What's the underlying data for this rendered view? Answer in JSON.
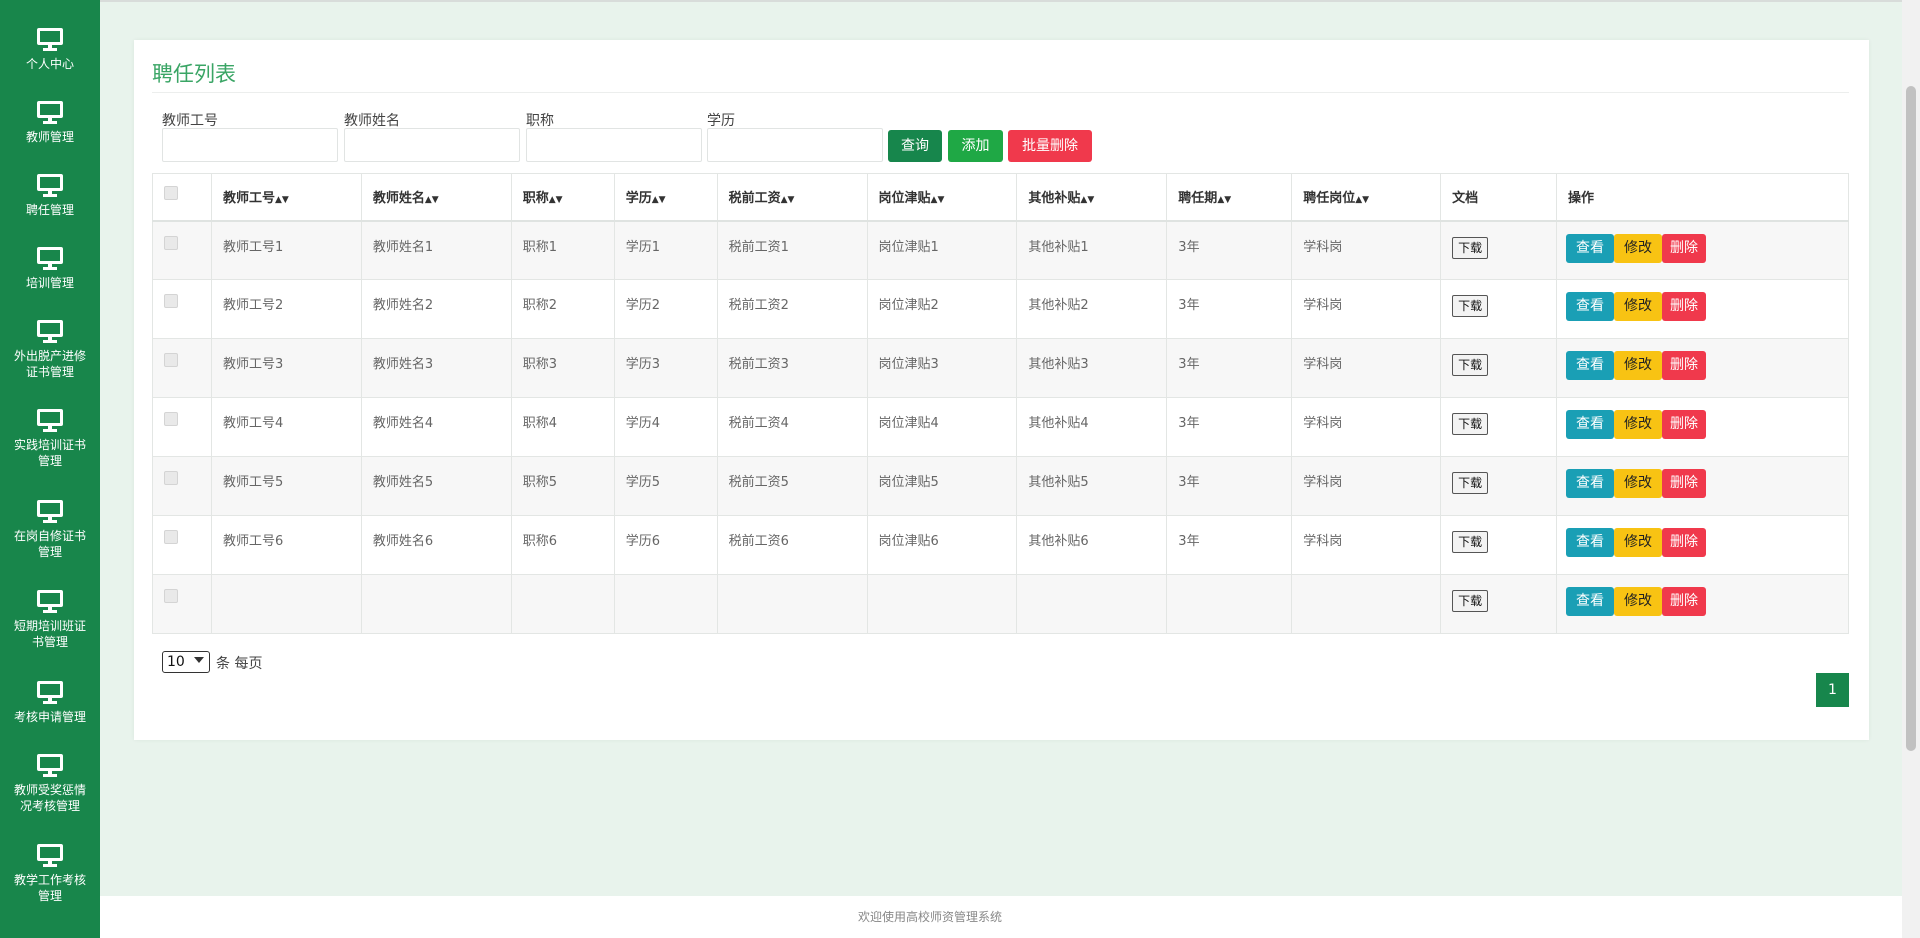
{
  "sidebar": {
    "items": [
      {
        "label": "个人中心"
      },
      {
        "label": "教师管理"
      },
      {
        "label": "聘任管理"
      },
      {
        "label": "培训管理"
      },
      {
        "label": "外出脱产进修证书管理"
      },
      {
        "label": "实践培训证书管理"
      },
      {
        "label": "在岗自修证书管理"
      },
      {
        "label": "短期培训班证书管理"
      },
      {
        "label": "考核申请管理"
      },
      {
        "label": "教师受奖惩情况考核管理"
      },
      {
        "label": "教学工作考核管理"
      }
    ]
  },
  "page": {
    "title": "聘任列表"
  },
  "search": {
    "fields": [
      {
        "label": "教师工号",
        "value": ""
      },
      {
        "label": "教师姓名",
        "value": ""
      },
      {
        "label": "职称",
        "value": ""
      },
      {
        "label": "学历",
        "value": ""
      }
    ],
    "query_label": "查询",
    "add_label": "添加",
    "batch_delete_label": "批量删除"
  },
  "table": {
    "columns": [
      "教师工号",
      "教师姓名",
      "职称",
      "学历",
      "税前工资",
      "岗位津贴",
      "其他补贴",
      "聘任期",
      "聘任岗位",
      "文档",
      "操作"
    ],
    "sortable": [
      true,
      true,
      true,
      true,
      true,
      true,
      true,
      true,
      true,
      false,
      false
    ],
    "download_label": "下载",
    "view_label": "查看",
    "edit_label": "修改",
    "delete_label": "删除",
    "rows": [
      [
        "教师工号1",
        "教师姓名1",
        "职称1",
        "学历1",
        "税前工资1",
        "岗位津贴1",
        "其他补贴1",
        "3年",
        "学科岗"
      ],
      [
        "教师工号2",
        "教师姓名2",
        "职称2",
        "学历2",
        "税前工资2",
        "岗位津贴2",
        "其他补贴2",
        "3年",
        "学科岗"
      ],
      [
        "教师工号3",
        "教师姓名3",
        "职称3",
        "学历3",
        "税前工资3",
        "岗位津贴3",
        "其他补贴3",
        "3年",
        "学科岗"
      ],
      [
        "教师工号4",
        "教师姓名4",
        "职称4",
        "学历4",
        "税前工资4",
        "岗位津贴4",
        "其他补贴4",
        "3年",
        "学科岗"
      ],
      [
        "教师工号5",
        "教师姓名5",
        "职称5",
        "学历5",
        "税前工资5",
        "岗位津贴5",
        "其他补贴5",
        "3年",
        "学科岗"
      ],
      [
        "教师工号6",
        "教师姓名6",
        "职称6",
        "学历6",
        "税前工资6",
        "岗位津贴6",
        "其他补贴6",
        "3年",
        "学科岗"
      ],
      [
        "",
        "",
        "",
        "",
        "",
        "",
        "",
        "",
        ""
      ]
    ]
  },
  "pagination": {
    "page_size": "10",
    "page_size_label": "条 每页",
    "current_page": "1"
  },
  "footer": {
    "text": "欢迎使用高校师资管理系统"
  },
  "colors": {
    "sidebar_bg": "#18864b",
    "title": "#3aa565",
    "primary": "#17864c",
    "success": "#1fa845",
    "danger": "#f0394c",
    "info": "#1a9fb5",
    "warning": "#f8c313"
  },
  "icons": {
    "sidebar_item": "monitor-icon",
    "sort": "sort-icon"
  }
}
